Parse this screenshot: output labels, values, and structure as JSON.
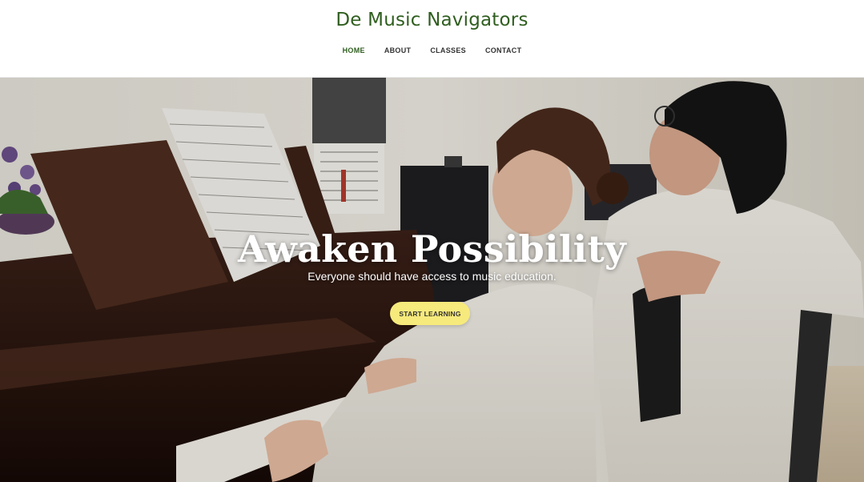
{
  "site": {
    "title": "De Music Navigators"
  },
  "nav": {
    "items": [
      {
        "label": "HOME",
        "active": true
      },
      {
        "label": "ABOUT",
        "active": false
      },
      {
        "label": "CLASSES",
        "active": false
      },
      {
        "label": "CONTACT",
        "active": false
      }
    ]
  },
  "hero": {
    "headline": "Awaken Possibility",
    "subheadline": "Everyone should have access to music education.",
    "cta_label": "START LEARNING",
    "image_subject": "teacher and girl playing piano"
  },
  "colors": {
    "brand_green": "#2f5e1f",
    "cta_yellow": "#f7ea7c"
  }
}
